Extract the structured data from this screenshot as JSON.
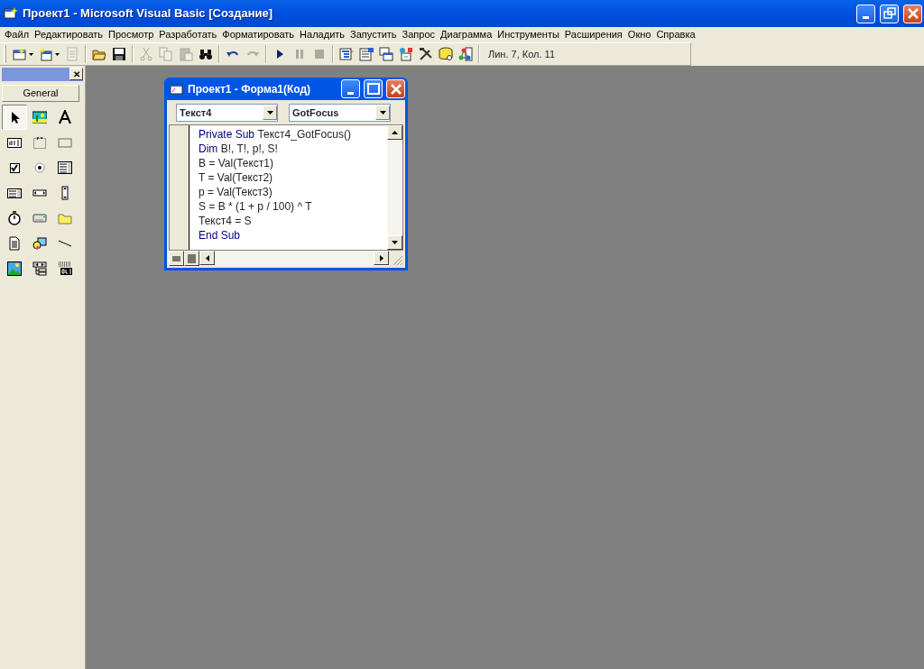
{
  "window": {
    "title": "Проект1 - Microsoft Visual Basic [Создание]"
  },
  "menu": [
    "Файл",
    "Редактировать",
    "Просмотр",
    "Разработать",
    "Форматировать",
    "Наладить",
    "Запустить",
    "Запрос",
    "Диаграмма",
    "Инструменты",
    "Расширения",
    "Окно",
    "Справка"
  ],
  "toolbar": {
    "groups": [
      [
        {
          "kind": "add-project",
          "disabled": false,
          "dropdown": true
        },
        {
          "kind": "add-form",
          "disabled": false,
          "dropdown": true
        },
        {
          "kind": "menu-editor",
          "disabled": true,
          "dropdown": false
        }
      ],
      [
        {
          "kind": "open",
          "disabled": false,
          "dropdown": false
        },
        {
          "kind": "save",
          "disabled": false,
          "dropdown": false
        }
      ],
      [
        {
          "kind": "cut",
          "disabled": true,
          "dropdown": false
        },
        {
          "kind": "copy",
          "disabled": true,
          "dropdown": false
        },
        {
          "kind": "paste",
          "disabled": true,
          "dropdown": false
        },
        {
          "kind": "find",
          "disabled": false,
          "dropdown": false
        }
      ],
      [
        {
          "kind": "undo",
          "disabled": false,
          "dropdown": false
        },
        {
          "kind": "redo",
          "disabled": true,
          "dropdown": false
        }
      ],
      [
        {
          "kind": "run",
          "disabled": false,
          "dropdown": false
        },
        {
          "kind": "pause",
          "disabled": true,
          "dropdown": false
        },
        {
          "kind": "stop",
          "disabled": true,
          "dropdown": false
        }
      ],
      [
        {
          "kind": "project",
          "disabled": false,
          "dropdown": false
        },
        {
          "kind": "properties",
          "disabled": false,
          "dropdown": false
        },
        {
          "kind": "layout",
          "disabled": false,
          "dropdown": false
        },
        {
          "kind": "browser",
          "disabled": false,
          "dropdown": false
        },
        {
          "kind": "tools",
          "disabled": false,
          "dropdown": false
        },
        {
          "kind": "data",
          "disabled": false,
          "dropdown": false
        },
        {
          "kind": "component",
          "disabled": false,
          "dropdown": false
        }
      ]
    ],
    "position": "Лин. 7, Кол. 11"
  },
  "toolbox": {
    "close": "✕",
    "tab": "General",
    "items": [
      {
        "kind": "pointer",
        "selected": true
      },
      {
        "kind": "picture",
        "selected": false
      },
      {
        "kind": "label",
        "selected": false
      },
      {
        "kind": "textbox",
        "selected": false
      },
      {
        "kind": "frame",
        "selected": false
      },
      {
        "kind": "command",
        "selected": false
      },
      {
        "kind": "checkbox",
        "selected": false
      },
      {
        "kind": "option",
        "selected": false
      },
      {
        "kind": "combo",
        "selected": false
      },
      {
        "kind": "list",
        "selected": false
      },
      {
        "kind": "hscroll",
        "selected": false
      },
      {
        "kind": "vscroll",
        "selected": false
      },
      {
        "kind": "timer",
        "selected": false
      },
      {
        "kind": "drive",
        "selected": false
      },
      {
        "kind": "dir",
        "selected": false
      },
      {
        "kind": "file",
        "selected": false
      },
      {
        "kind": "shape",
        "selected": false
      },
      {
        "kind": "line",
        "selected": false
      },
      {
        "kind": "image",
        "selected": false
      },
      {
        "kind": "datactl",
        "selected": false
      },
      {
        "kind": "ole",
        "selected": false
      }
    ]
  },
  "code_window": {
    "title": "Проект1 - Форма1(Код)",
    "object": "Текст4",
    "procedure": "GotFocus",
    "lines": [
      "**Private Sub** Текст4_GotFocus()",
      "**Dim** B!, T!, p!, S!",
      "B = Val(Текст1)",
      "T = Val(Текст2)",
      "p = Val(Текст3)",
      "S = B * (1 + p / 100) ^ T",
      "Текст4 = S",
      "**End Sub**"
    ]
  }
}
